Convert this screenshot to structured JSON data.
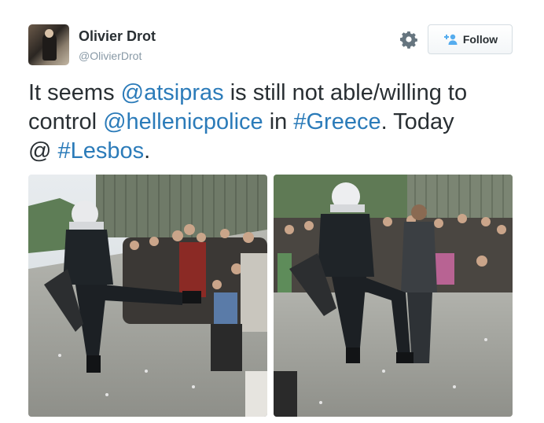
{
  "author": {
    "name": "Olivier Drot",
    "handle": "@OlivierDrot",
    "avatar_icon": "user-avatar"
  },
  "actions": {
    "gear_icon": "gear-icon",
    "follow_icon": "add-user-icon",
    "follow_label": "Follow"
  },
  "tweet": {
    "line1": {
      "t1": "It seems ",
      "mention1": "@atsipras",
      "t2": " is still not able/willing to"
    },
    "line2": {
      "t1": "control ",
      "mention2": "@hellenicpolice",
      "t2": " in ",
      "hashtag1": "#Greece",
      "t3": ". Today"
    },
    "line3": {
      "t1": "@ ",
      "hashtag2": "#Lesbos",
      "t2": "."
    }
  },
  "media": {
    "photos": [
      {
        "description_icon": "photo-riot-police-kick-left"
      },
      {
        "description_icon": "photo-riot-police-kick-right"
      }
    ]
  },
  "colors": {
    "text": "#292f33",
    "link": "#2b7bb9",
    "muted": "#8899a6",
    "border": "#d5dde2"
  }
}
